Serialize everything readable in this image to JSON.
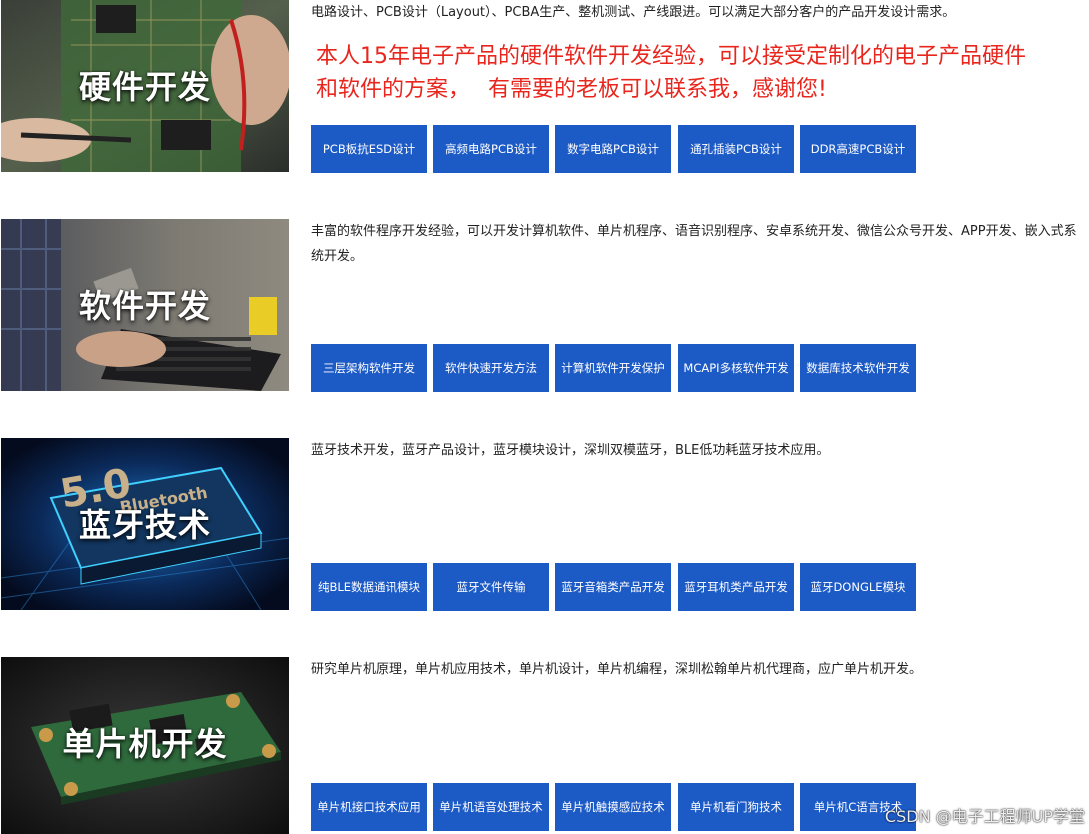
{
  "sections": [
    {
      "title": "硬件开发",
      "desc": "电路设计、PCB设计（Layout）、PCBA生产、整机测试、产线跟进。可以满足大部分客户的产品开发设计需求。",
      "highlight_line1": "本人15年电子产品的硬件软件开发经验，可以接受定制化的电子产品硬件",
      "highlight_line2": "和软件的方案，　 有需要的老板可以联系我，感谢您!",
      "buttons": [
        "PCB板抗ESD设计",
        "高频电路PCB设计",
        "数字电路PCB设计",
        "通孔插装PCB设计",
        "DDR高速PCB设计"
      ]
    },
    {
      "title": "软件开发",
      "desc": "丰富的软件程序开发经验，可以开发计算机软件、单片机程序、语音识别程序、安卓系统开发、微信公众号开发、APP开发、嵌入式系统开发。",
      "buttons": [
        "三层架构软件开发",
        "软件快速开发方法",
        "计算机软件开发保护",
        "MCAPI多核软件开发",
        "数据库技术软件开发"
      ]
    },
    {
      "title": "蓝牙技术",
      "desc": "蓝牙技术开发，蓝牙产品设计，蓝牙模块设计，深圳双模蓝牙，BLE低功耗蓝牙技术应用。",
      "image_text_big": "5.0",
      "image_text_small": "Bluetooth",
      "buttons": [
        "纯BLE数据通讯模块",
        "蓝牙文件传输",
        "蓝牙音箱类产品开发",
        "蓝牙耳机类产品开发",
        "蓝牙DONGLE模块"
      ]
    },
    {
      "title": "单片机开发",
      "desc": "研究单片机原理，单片机应用技术，单片机设计，单片机编程，深圳松翰单片机代理商，应广单片机开发。",
      "buttons": [
        "单片机接口技术应用",
        "单片机语音处理技术",
        "单片机触摸感应技术",
        "单片机看门狗技术",
        "单片机C语言技术"
      ]
    }
  ],
  "watermark": "CSDN @电子工程师UP学堂",
  "colors": {
    "button_bg": "#1c5ac6",
    "highlight": "#e8261e",
    "body_text": "#222222"
  }
}
